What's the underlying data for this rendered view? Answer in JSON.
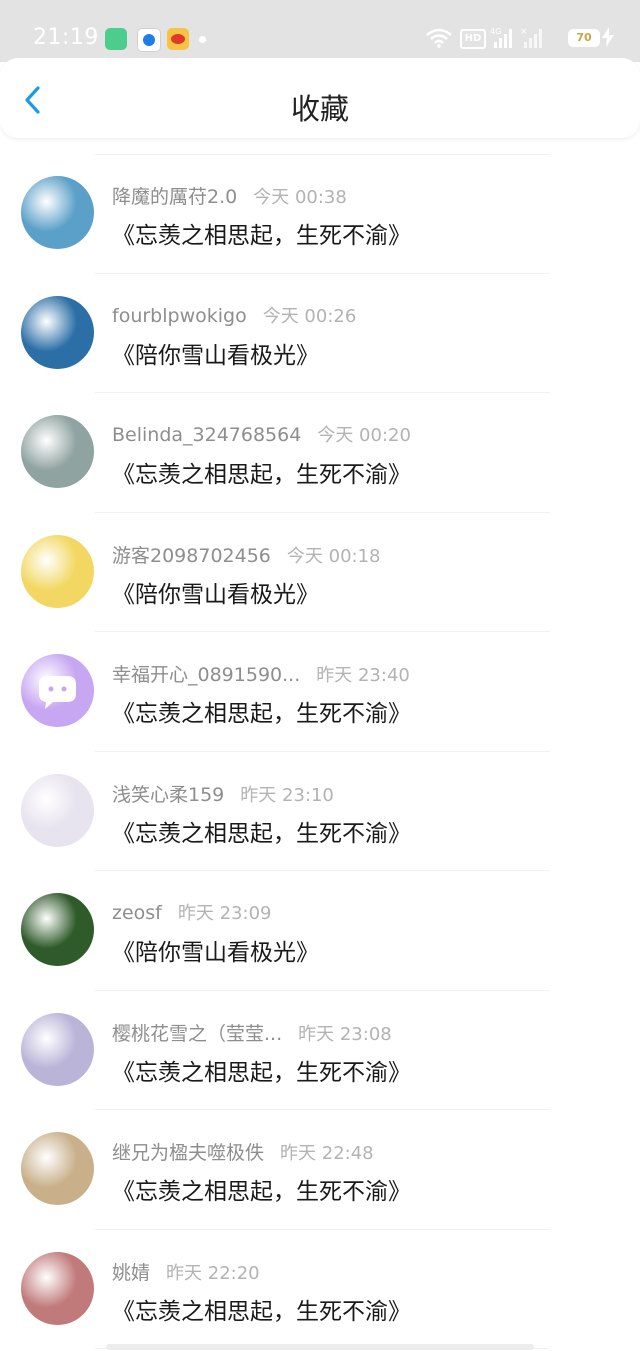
{
  "status_bar": {
    "time": "21:19",
    "network": "4G",
    "battery": "70",
    "icons": [
      "green-app-icon",
      "blue-app-icon",
      "weibo-icon",
      "wifi-icon",
      "hd-icon",
      "signal-icon",
      "battery-icon",
      "charging-bolt-icon"
    ]
  },
  "header": {
    "title": "收藏",
    "back_icon": "chevron-left-icon",
    "accent_color": "#1a9be8"
  },
  "favorites": [
    {
      "username": "降魔的厲苻2.0",
      "time": "今天 00:38",
      "message": "《忘羡之相思起，生死不渝》",
      "avatar_color": "#5aa0c8"
    },
    {
      "username": "fourblpwokigo",
      "time": "今天 00:26",
      "message": "《陪你雪山看极光》",
      "avatar_color": "#2c6fa6"
    },
    {
      "username": "Belinda_324768564",
      "time": "今天 00:20",
      "message": "《忘羡之相思起，生死不渝》",
      "avatar_color": "#8fa3a0"
    },
    {
      "username": "游客2098702456",
      "time": "今天 00:18",
      "message": "《陪你雪山看极光》",
      "avatar_color": "#f2d862"
    },
    {
      "username": "幸福开心_0891590...",
      "time": "昨天 23:40",
      "message": "《忘羡之相思起，生死不渝》",
      "avatar_color": "#c7a6f2"
    },
    {
      "username": "浅笑心柔159",
      "time": "昨天 23:10",
      "message": "《忘羡之相思起，生死不渝》",
      "avatar_color": "#e7e3ef"
    },
    {
      "username": "zeosf",
      "time": "昨天 23:09",
      "message": "《陪你雪山看极光》",
      "avatar_color": "#2f5a2a"
    },
    {
      "username": "樱桃花雪之（莹莹...",
      "time": "昨天 23:08",
      "message": "《忘羡之相思起，生死不渝》",
      "avatar_color": "#b9b4d8"
    },
    {
      "username": "继兄为楹夫噬极佚",
      "time": "昨天 22:48",
      "message": "《忘羡之相思起，生死不渝》",
      "avatar_color": "#c9b08a"
    },
    {
      "username": "姚婧",
      "time": "昨天 22:20",
      "message": "《忘羡之相思起，生死不渝》",
      "avatar_color": "#c07a7a"
    }
  ]
}
